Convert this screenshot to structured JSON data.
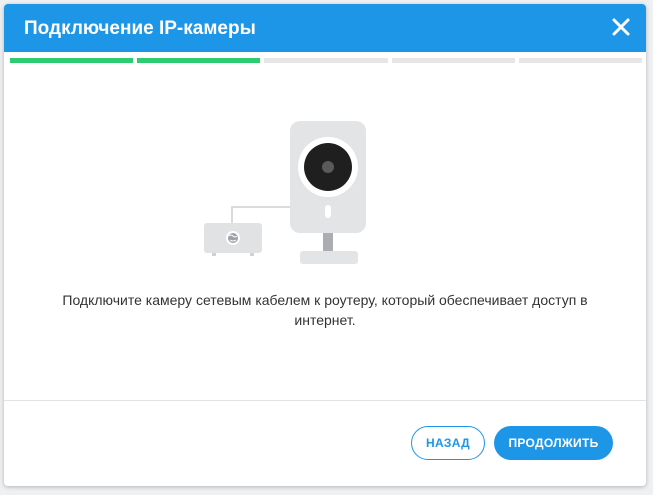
{
  "dialog": {
    "title": "Подключение IP-камеры",
    "close_icon": "close-icon",
    "progress": {
      "total_steps": 5,
      "completed_steps": 2,
      "done_color": "#2ecc71",
      "pending_color": "#e6e6e6"
    },
    "illustration": {
      "icons": [
        "camera-icon",
        "router-icon",
        "globe-icon",
        "cable-icon"
      ]
    },
    "message": "Подключите камеру сетевым кабелем к роутеру, который обеспечивает доступ в интернет.",
    "buttons": {
      "back_label": "НАЗАД",
      "next_label": "ПРОДОЛЖИТЬ"
    }
  },
  "colors": {
    "header": "#1e96e8",
    "accent": "#1e96e8"
  }
}
